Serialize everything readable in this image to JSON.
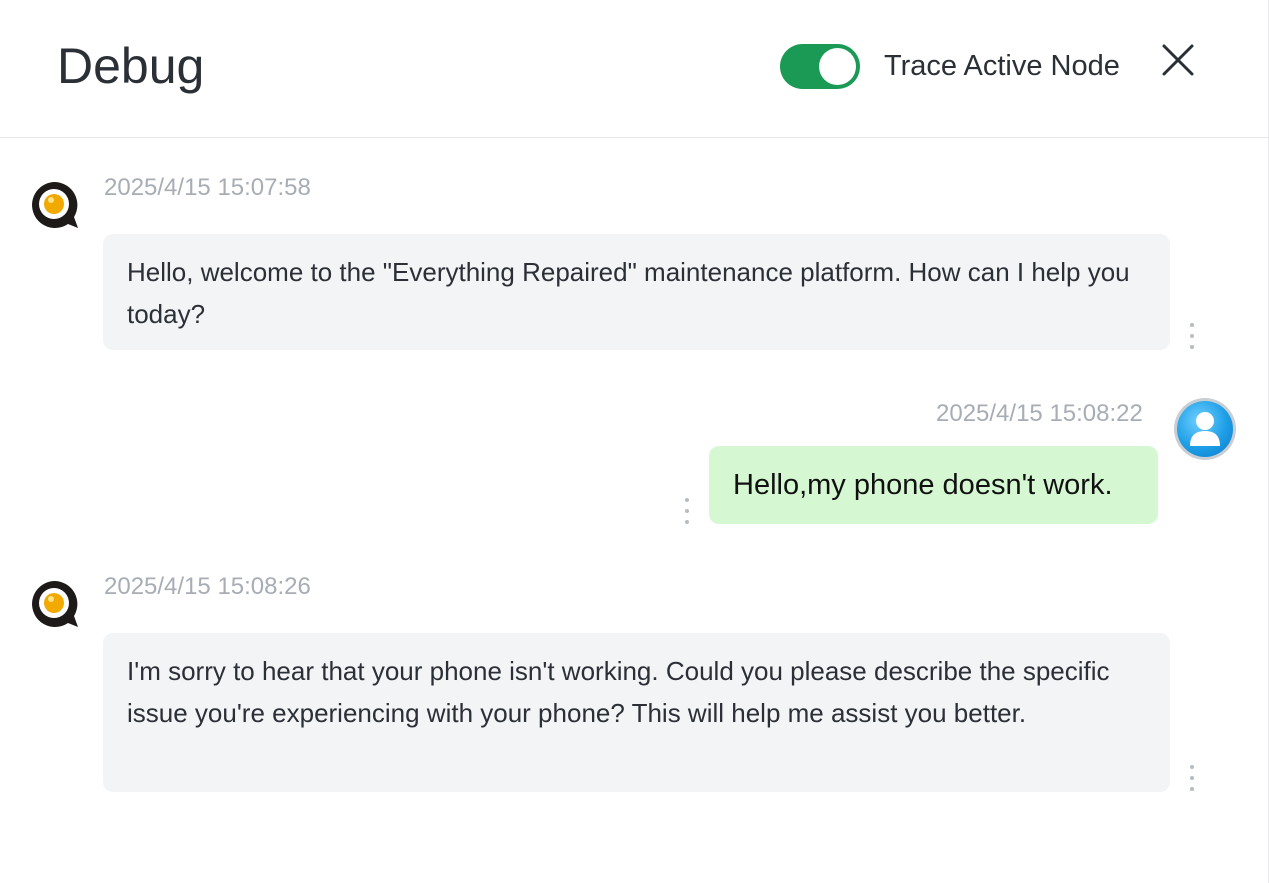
{
  "header": {
    "title": "Debug",
    "toggle": {
      "label": "Trace Active Node",
      "on": true,
      "color": "#1a9a55"
    },
    "close_icon": "close-icon"
  },
  "messages": [
    {
      "role": "assistant",
      "time": "2025/4/15 15:07:58",
      "text": "Hello, welcome to the \"Everything Repaired\" maintenance platform. How can I help you today?"
    },
    {
      "role": "user",
      "time": "2025/4/15 15:08:22",
      "text": "Hello,my phone doesn't work."
    },
    {
      "role": "assistant",
      "time": "2025/4/15 15:08:26",
      "text": "I'm sorry to hear that your phone isn't working. Could you please describe the specific issue you're experiencing with your phone? This will help me assist you better."
    }
  ],
  "colors": {
    "assistant_bubble": "#f3f4f6",
    "user_bubble": "#d5f8d3",
    "timestamp": "#a8adb5"
  }
}
